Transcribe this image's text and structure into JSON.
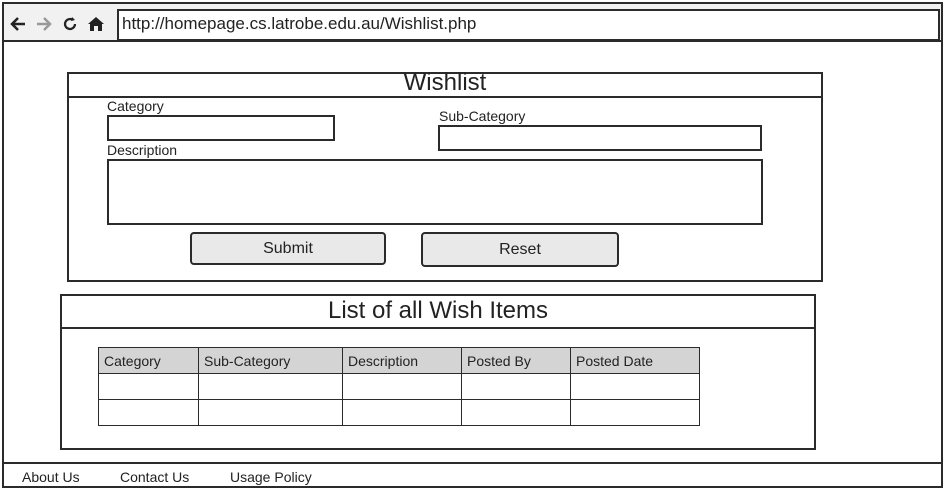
{
  "browser": {
    "url": "http://homepage.cs.latrobe.edu.au/Wishlist.php",
    "nav_icons": [
      "back-arrow-icon",
      "forward-arrow-icon",
      "reload-icon",
      "home-icon"
    ]
  },
  "wishlist_form": {
    "title": "Wishlist",
    "category_label": "Category",
    "subcategory_label": "Sub-Category",
    "description_label": "Description",
    "category_value": "",
    "subcategory_value": "",
    "description_value": "",
    "submit_label": "Submit",
    "reset_label": "Reset"
  },
  "wish_list": {
    "title": "List of all Wish Items",
    "columns": [
      "Category",
      "Sub-Category",
      "Description",
      "Posted By",
      "Posted Date"
    ],
    "rows": [
      [
        "",
        "",
        "",
        "",
        ""
      ],
      [
        "",
        "",
        "",
        "",
        ""
      ]
    ]
  },
  "footer": {
    "links": [
      "About Us",
      "Contact Us",
      "Usage Policy"
    ]
  }
}
